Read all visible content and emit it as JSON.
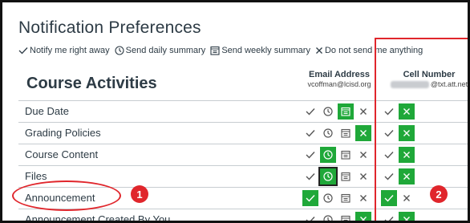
{
  "title": "Notification Preferences",
  "legend": {
    "right_away": "Notify me right away",
    "daily": "Send daily summary",
    "weekly": "Send weekly summary",
    "never": "Do not send me anything"
  },
  "table": {
    "section_heading": "Course Activities",
    "email_header": "Email Address",
    "email_value": "vcoffman@lcisd.org",
    "cell_header": "Cell Number",
    "cell_value_suffix": "@txt.att.net",
    "rows": [
      {
        "name": "Due Date",
        "email_selected": "weekly",
        "cell_selected": "never"
      },
      {
        "name": "Grading Policies",
        "email_selected": "never",
        "cell_selected": "never"
      },
      {
        "name": "Course Content",
        "email_selected": "daily",
        "cell_selected": "never"
      },
      {
        "name": "Files",
        "email_selected": "daily",
        "cell_selected": "never"
      },
      {
        "name": "Announcement",
        "email_selected": "right_away",
        "cell_selected": "right_away"
      },
      {
        "name": "Announcement Created By You",
        "email_selected": "never",
        "cell_selected": "never"
      }
    ]
  },
  "annotations": {
    "badge1": "1",
    "badge2": "2"
  },
  "colors": {
    "selected": "#1fa839",
    "annotation_red": "#e0262c",
    "text": "#2d3b45"
  }
}
